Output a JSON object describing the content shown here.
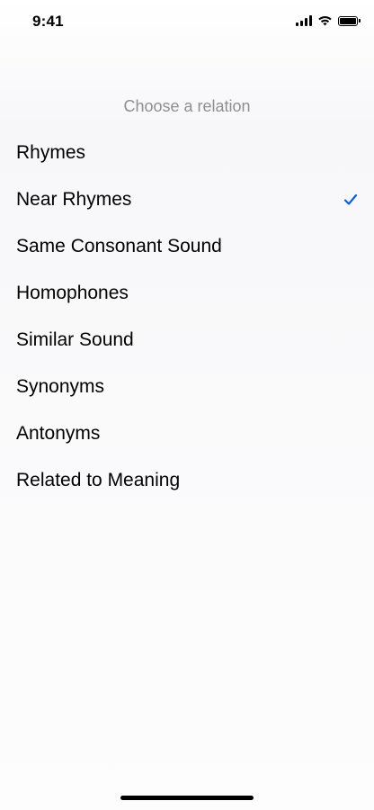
{
  "status_bar": {
    "time": "9:41",
    "icons": [
      "signal-icon",
      "wifi-icon",
      "battery-icon"
    ],
    "battery_level": 1.0
  },
  "sheet": {
    "title": "Choose a relation",
    "accent_color": "#0a60d8",
    "options": [
      {
        "label": "Rhymes",
        "selected": false
      },
      {
        "label": "Near Rhymes",
        "selected": true
      },
      {
        "label": "Same Consonant Sound",
        "selected": false
      },
      {
        "label": "Homophones",
        "selected": false
      },
      {
        "label": "Similar Sound",
        "selected": false
      },
      {
        "label": "Synonyms",
        "selected": false
      },
      {
        "label": "Antonyms",
        "selected": false
      },
      {
        "label": "Related to Meaning",
        "selected": false
      }
    ]
  }
}
